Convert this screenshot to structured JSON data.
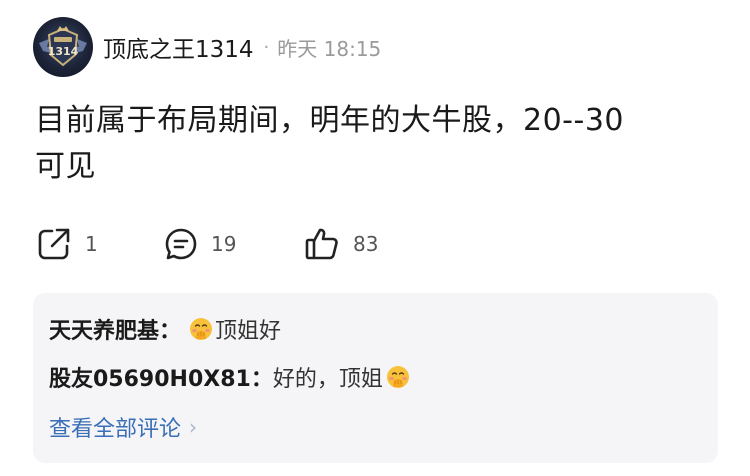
{
  "post": {
    "author": "顶底之王1314",
    "avatar_badge": "1314",
    "separator": "·",
    "time": "昨天 18:15",
    "content_line1": "目前属于布局期间，明年的大牛股，20--30",
    "content_line2": "可见"
  },
  "actions": {
    "share_icon": "share-icon",
    "share_count": "1",
    "comment_icon": "comment-icon",
    "comment_count": "19",
    "like_icon": "thumbs-up-icon",
    "like_count": "83"
  },
  "comments": [
    {
      "author": "天天养肥基：",
      "emoji": "smiling-face-with-hand-over-mouth",
      "text": "顶姐好"
    },
    {
      "author": "股友05690H0X81：",
      "text": "好的，顶姐",
      "emoji": "smiling-face-with-hand-over-mouth"
    }
  ],
  "view_all": {
    "label": "查看全部评论",
    "chevron": "›"
  },
  "colors": {
    "link": "#3a6fb7",
    "muted": "#9a9a9a",
    "panel_bg": "#f5f5f7"
  }
}
